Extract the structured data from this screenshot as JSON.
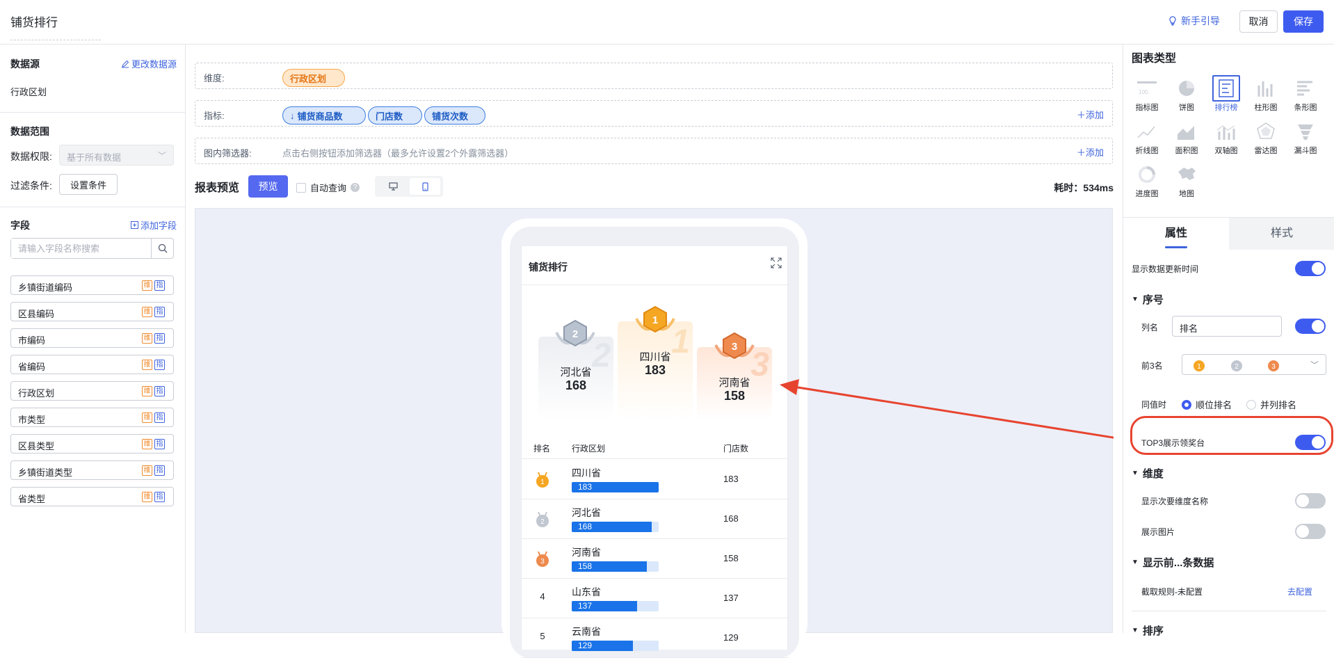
{
  "header": {
    "title": "铺货排行",
    "guide": "新手引导",
    "cancel": "取消",
    "save": "保存"
  },
  "left": {
    "datasource_title": "数据源",
    "change_source": "更改数据源",
    "datasource_value": "行政区划",
    "range_title": "数据范围",
    "perm_label": "数据权限:",
    "perm_value": "基于所有数据",
    "filter_label": "过滤条件:",
    "filter_btn": "设置条件",
    "fields_title": "字段",
    "add_field": "添加字段",
    "search_placeholder": "请输入字段名称搜索",
    "tag_dim": "维",
    "tag_ind": "指",
    "fields": [
      "乡镇街道编码",
      "区县编码",
      "市编码",
      "省编码",
      "行政区划",
      "市类型",
      "区县类型",
      "乡镇街道类型",
      "省类型"
    ]
  },
  "config": {
    "dim_label": "维度:",
    "dim_chip": "行政区划",
    "ind_label": "指标:",
    "ind_chips": [
      "铺货商品数",
      "门店数",
      "铺货次数"
    ],
    "add": "添加",
    "filter_label": "图内筛选器:",
    "filter_hint": "点击右侧按钮添加筛选器（最多允许设置2个外露筛选器）"
  },
  "preview": {
    "title": "报表预览",
    "btn": "预览",
    "auto": "自动查询",
    "q": "?",
    "timing": "耗时：534ms"
  },
  "card": {
    "title": "铺货排行",
    "podium": [
      {
        "rank": "2",
        "name": "河北省",
        "value": "168"
      },
      {
        "rank": "1",
        "name": "四川省",
        "value": "183"
      },
      {
        "rank": "3",
        "name": "河南省",
        "value": "158"
      }
    ],
    "headers": [
      "排名",
      "行政区划",
      "门店数"
    ],
    "rows": [
      {
        "rank": "",
        "name": "四川省",
        "value": "183",
        "pct": 100
      },
      {
        "rank": "",
        "name": "河北省",
        "value": "168",
        "pct": 92
      },
      {
        "rank": "",
        "name": "河南省",
        "value": "158",
        "pct": 86
      },
      {
        "rank": "4",
        "name": "山东省",
        "value": "137",
        "pct": 75
      },
      {
        "rank": "5",
        "name": "云南省",
        "value": "129",
        "pct": 70
      }
    ]
  },
  "right": {
    "chart_type_title": "图表类型",
    "types": [
      "指标图",
      "饼图",
      "排行榜",
      "柱形图",
      "条形图",
      "折线图",
      "面积图",
      "双轴图",
      "雷达图",
      "漏斗图",
      "进度图",
      "地图"
    ],
    "selected_type": "排行榜",
    "tab_props": "属性",
    "tab_style": "样式",
    "show_update": "显示数据更新时间",
    "seq_group": "序号",
    "col_name_label": "列名",
    "col_name_value": "排名",
    "top3_label": "前3名",
    "tie_label": "同值时",
    "tie_opt1": "顺位排名",
    "tie_opt2": "并列排名",
    "top3_podium": "TOP3展示领奖台",
    "dim_group": "维度",
    "show_sub": "显示次要维度名称",
    "show_img": "展示图片",
    "topn_group": "显示前...条数据",
    "cut_rule": "截取规则-未配置",
    "goto_cfg": "去配置",
    "sort_group": "排序"
  },
  "colors": {
    "accent": "#3e5bf0",
    "gold": "#f5a623",
    "silver": "#9aa3af",
    "bronze": "#e8813a",
    "annotation": "#e74430"
  }
}
